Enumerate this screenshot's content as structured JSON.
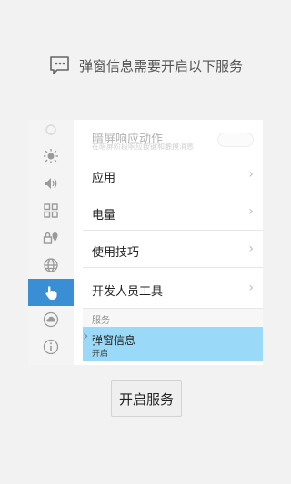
{
  "header": {
    "title": "弹窗信息需要开启以下服务"
  },
  "settings": {
    "top_faded": {
      "title": "暗屏响应动作",
      "subtitle": "在暗屏阶段响应按键和触摸消息"
    },
    "items": [
      {
        "label": "应用"
      },
      {
        "label": "电量"
      },
      {
        "label": "使用技巧"
      },
      {
        "label": "开发人员工具"
      }
    ],
    "section_label": "服务",
    "selected_item": {
      "title": "弹窗信息",
      "status": "开启"
    }
  },
  "sidebar": {
    "icons": [
      "settings-icon",
      "brightness-icon",
      "volume-icon",
      "apps-grid-icon",
      "location-lock-icon",
      "globe-icon",
      "touch-icon",
      "cloud-icon",
      "info-icon"
    ],
    "active_index": 6
  },
  "actions": {
    "start_service": "开启服务"
  },
  "colors": {
    "accent_blue": "#3a8fd4",
    "selected_bg": "#9ad9f7",
    "page_bg": "#f2f2f2"
  }
}
